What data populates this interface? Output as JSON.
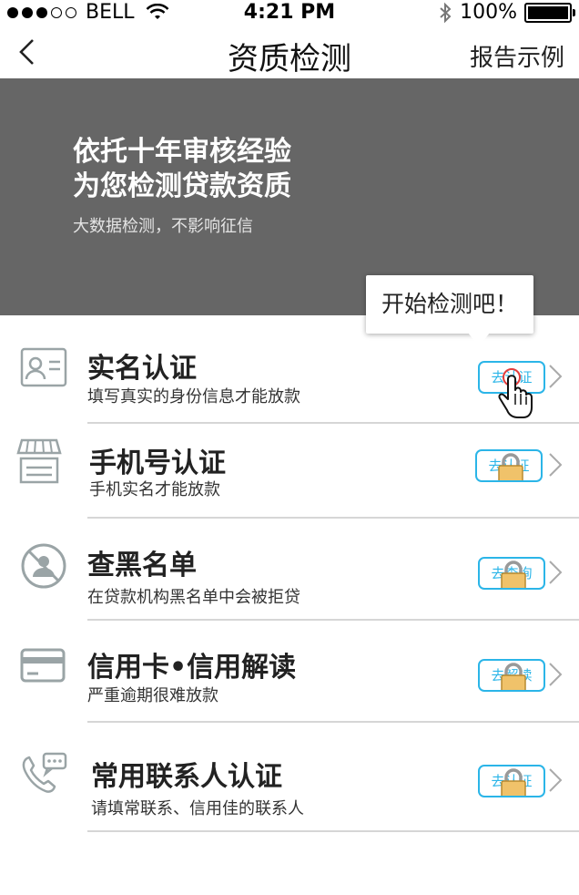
{
  "status_bar": {
    "carrier": "BELL",
    "time": "4:21 PM",
    "battery": "100%"
  },
  "nav": {
    "title": "资质检测",
    "right_action": "报告示例"
  },
  "banner": {
    "headline_1": "依托十年审核经验",
    "headline_2": "为您检测贷款资质",
    "subtitle": "大数据检测，不影响征信"
  },
  "tooltip": {
    "text": "开始检测吧！"
  },
  "items": [
    {
      "title": "实名认证",
      "desc": "填写真实的身份信息才能放款",
      "button": "去认证",
      "icon": "id-card-icon",
      "locked": false
    },
    {
      "title": "手机号认证",
      "desc": "手机实名才能放款",
      "button": "去认证",
      "icon": "store-icon",
      "locked": true
    },
    {
      "title": "查黑名单",
      "desc": "在贷款机构黑名单中会被拒贷",
      "button": "去查询",
      "icon": "blacklist-icon",
      "locked": true
    },
    {
      "title": "信用卡•信用解读",
      "desc": "严重逾期很难放款",
      "button": "去解读",
      "icon": "credit-card-icon",
      "locked": true
    },
    {
      "title": "常用联系人认证",
      "desc": "请填常联系、信用佳的联系人",
      "button": "去认证",
      "icon": "phone-chat-icon",
      "locked": true
    }
  ],
  "colors": {
    "accent": "#2bb5e8",
    "banner_bg": "#666666",
    "icon_gray": "#9aa4a6"
  }
}
